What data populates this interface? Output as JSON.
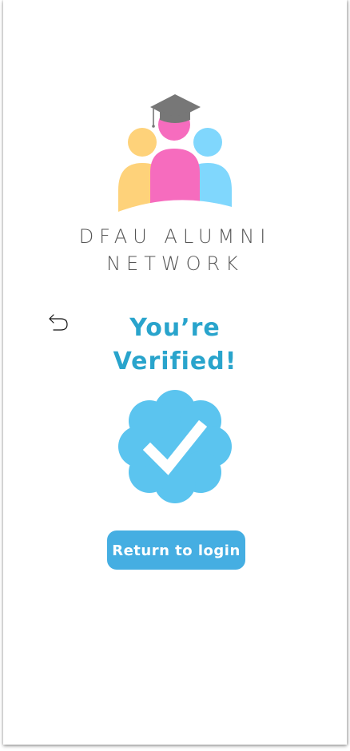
{
  "brand": {
    "line1": "DFAU ALUMNI",
    "line2": "NETWORK",
    "logo_icon": "alumni-graduation-logo"
  },
  "nav": {
    "back_icon": "back-arrow-icon"
  },
  "status": {
    "title_line1": "You’re",
    "title_line2": "Verified!",
    "badge_icon": "verified-check-badge-icon"
  },
  "actions": {
    "return_label": "Return to login"
  },
  "colors": {
    "accent_text": "#29a4cc",
    "button": "#45aee2",
    "badge": "#5bc4ef",
    "logo_yellow": "#fed27a",
    "logo_pink": "#f66cbe",
    "logo_blue": "#80d7fd",
    "cap": "#777777"
  }
}
